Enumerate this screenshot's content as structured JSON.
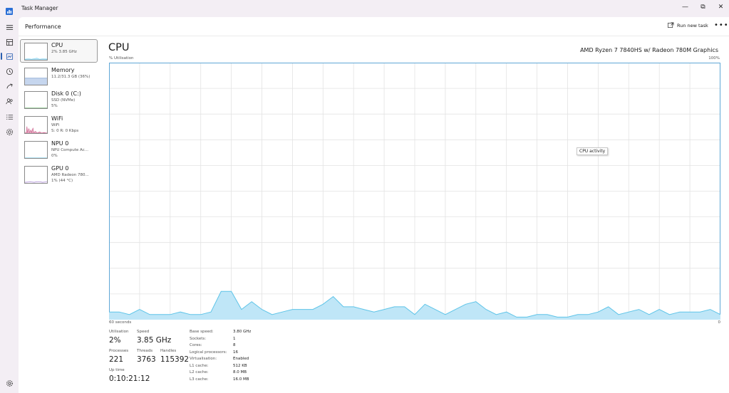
{
  "window": {
    "title": "Task Manager",
    "controls": {
      "minimize": "—",
      "restore": "⧉",
      "close": "✕"
    }
  },
  "header": {
    "title": "Performance",
    "run_new_task": "Run new task",
    "more": "•••"
  },
  "rail": {
    "items": [
      "menu-icon",
      "processes-icon",
      "performance-icon",
      "app-history-icon",
      "startup-apps-icon",
      "users-icon",
      "details-icon",
      "services-icon",
      "settings-icon"
    ]
  },
  "sidebar": {
    "items": [
      {
        "name": "CPU",
        "sub1": "2% 3.85 GHz",
        "sub2": ""
      },
      {
        "name": "Memory",
        "sub1": "11.2/31.3 GB (36%)",
        "sub2": ""
      },
      {
        "name": "Disk 0 (C:)",
        "sub1": "SSD (NVMe)",
        "sub2": "5%"
      },
      {
        "name": "WiFi",
        "sub1": "WiFi",
        "sub2": "S: 0 R: 0 Kbps"
      },
      {
        "name": "NPU 0",
        "sub1": "NPU Compute Ac...",
        "sub2": "0%"
      },
      {
        "name": "GPU 0",
        "sub1": "AMD Radeon 780...",
        "sub2": "1% (44 °C)"
      }
    ]
  },
  "main": {
    "title": "CPU",
    "model": "AMD Ryzen 7 7840HS w/ Radeon 780M Graphics",
    "y_label": "% Utilisation",
    "y_max": "100%",
    "x_left": "60 seconds",
    "x_right": "0",
    "tooltip": "CPU activity",
    "stats": {
      "utilisation_label": "Utilisation",
      "utilisation": "2%",
      "speed_label": "Speed",
      "speed": "3.85 GHz",
      "processes_label": "Processes",
      "processes": "221",
      "threads_label": "Threads",
      "threads": "3763",
      "handles_label": "Handles",
      "handles": "115392",
      "uptime_label": "Up time",
      "uptime": "0:10:21:12"
    },
    "specs": [
      {
        "label": "Base speed:",
        "value": "3.80 GHz"
      },
      {
        "label": "Sockets:",
        "value": "1"
      },
      {
        "label": "Cores:",
        "value": "8"
      },
      {
        "label": "Logical processors:",
        "value": "16"
      },
      {
        "label": "Virtualisation:",
        "value": "Enabled"
      },
      {
        "label": "L1 cache:",
        "value": "512 KB"
      },
      {
        "label": "L2 cache:",
        "value": "8.0 MB"
      },
      {
        "label": "L3 cache:",
        "value": "16.0 MB"
      }
    ]
  },
  "colors": {
    "cpu_line": "#5ec4e8",
    "cpu_fill": "#bfe6f7",
    "memory_fill": "#c6d6ee",
    "wifi_line": "#c0306a",
    "gpu_line": "#8a5ac8",
    "grid": "#e3e3e3",
    "accent": "#2a5fb0"
  },
  "chart_data": {
    "type": "area",
    "title": "",
    "ylim": [
      0,
      100
    ],
    "xlim": [
      60,
      0
    ],
    "values": [
      3,
      3,
      2,
      4,
      2,
      2,
      2,
      3,
      2,
      2,
      3,
      11,
      11,
      4,
      7,
      4,
      2,
      3,
      4,
      4,
      4,
      6,
      9,
      5,
      5,
      4,
      3,
      4,
      5,
      5,
      2,
      6,
      4,
      2,
      4,
      6,
      7,
      4,
      2,
      3,
      1,
      1,
      2,
      2,
      1,
      1,
      2,
      2,
      3,
      5,
      2,
      3,
      4,
      2,
      4,
      2,
      3,
      3,
      3,
      4,
      2
    ]
  }
}
